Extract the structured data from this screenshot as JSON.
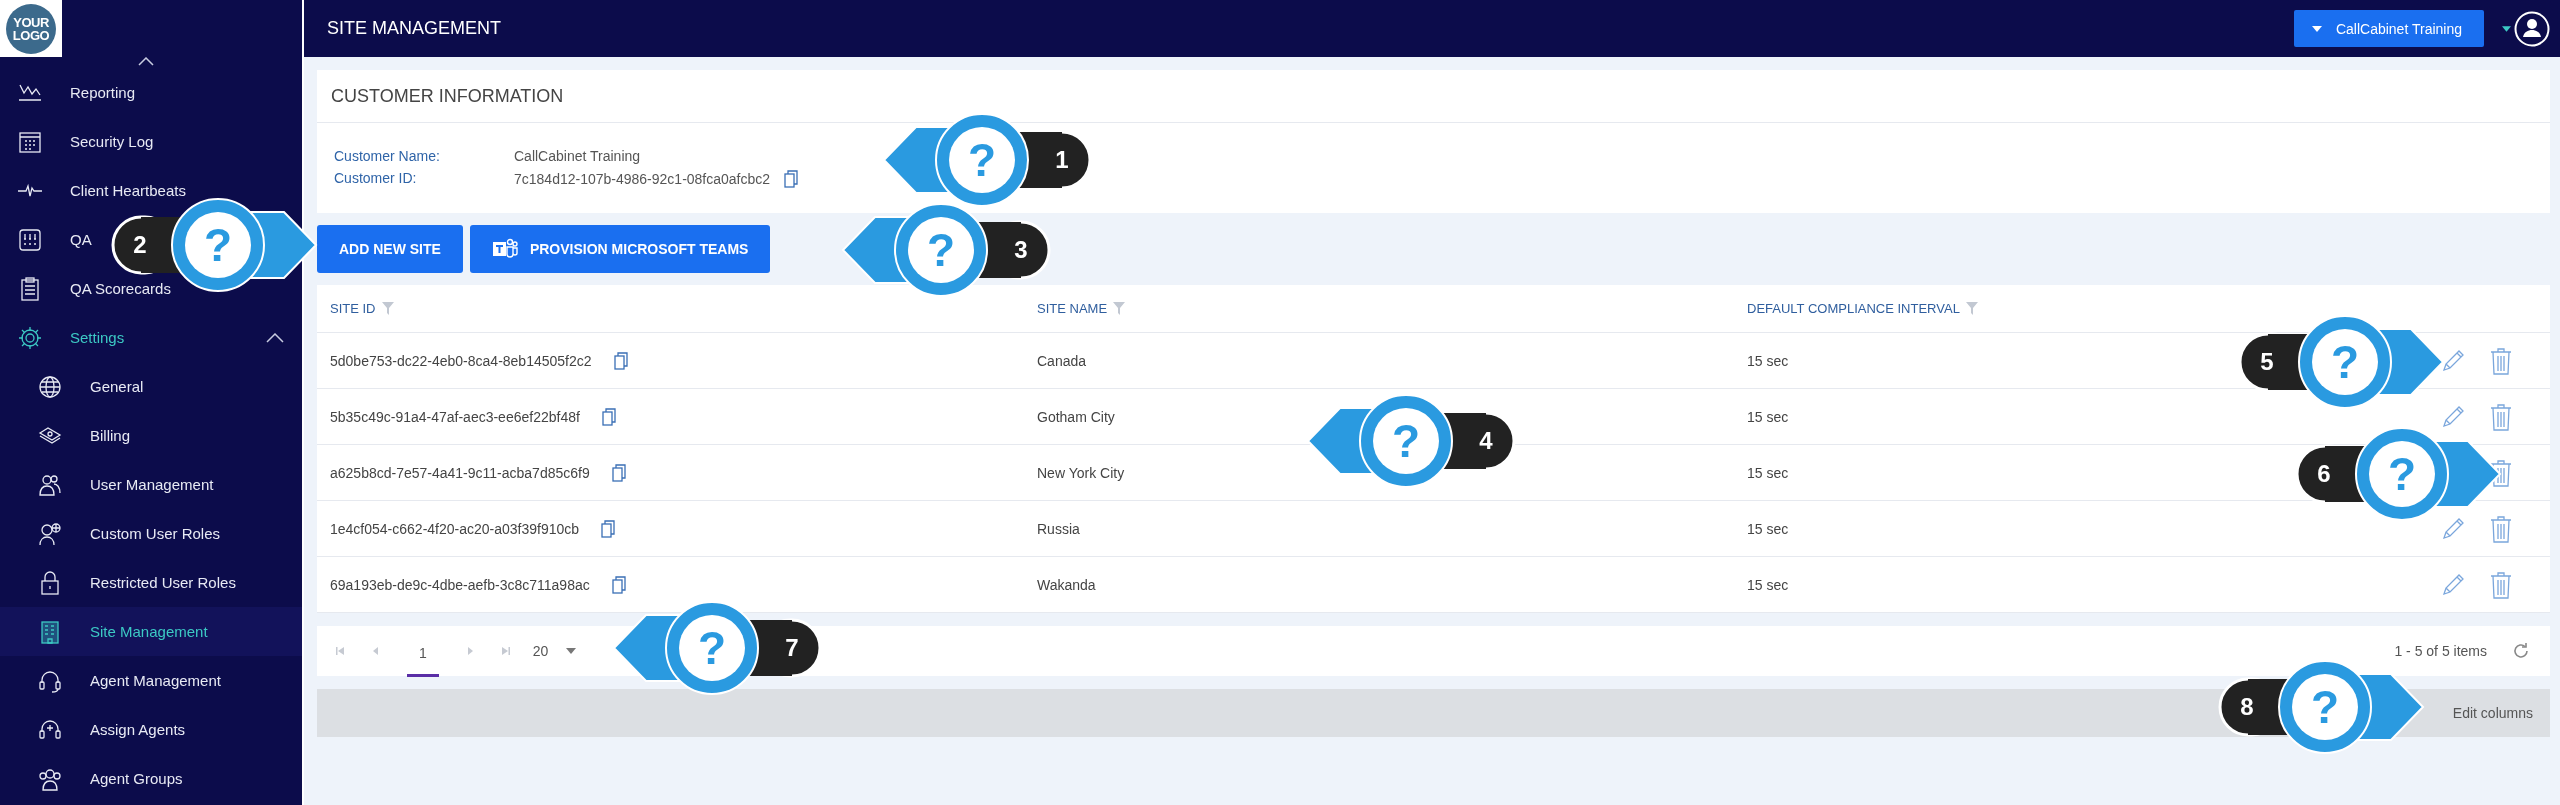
{
  "logo": {
    "line_1": "YOUR",
    "line_2": "LOGO"
  },
  "sidebar": {
    "items": [
      {
        "label": "Reporting",
        "selected": false
      },
      {
        "label": "Security Log",
        "selected": false
      },
      {
        "label": "Client Heartbeats",
        "selected": false
      },
      {
        "label": "QA",
        "selected": false
      },
      {
        "label": "QA Scorecards",
        "selected": false
      },
      {
        "label": "Settings",
        "selected": false,
        "expanded": true,
        "children": [
          {
            "label": "General",
            "selected": false
          },
          {
            "label": "Billing",
            "selected": false
          },
          {
            "label": "User Management",
            "selected": false
          },
          {
            "label": "Custom User Roles",
            "selected": false
          },
          {
            "label": "Restricted User Roles",
            "selected": false
          },
          {
            "label": "Site Management",
            "selected": true
          },
          {
            "label": "Agent Management",
            "selected": false
          },
          {
            "label": "Assign Agents",
            "selected": false
          },
          {
            "label": "Agent Groups",
            "selected": false
          }
        ]
      }
    ]
  },
  "header": {
    "title": "SITE MANAGEMENT",
    "account_button": "CallCabinet Training"
  },
  "customer_info": {
    "title": "CUSTOMER INFORMATION",
    "fields": [
      {
        "label": "Customer Name:",
        "value": "CallCabinet Training",
        "copyable": false
      },
      {
        "label": "Customer ID:",
        "value": "7c184d12-107b-4986-92c1-08fca0afcbc2",
        "copyable": true
      }
    ]
  },
  "buttons": [
    {
      "label": "ADD NEW SITE",
      "kind": "plain"
    },
    {
      "label": "PROVISION MICROSOFT TEAMS",
      "kind": "teams"
    }
  ],
  "table": {
    "columns": [
      {
        "label": "SITE ID"
      },
      {
        "label": "SITE NAME"
      },
      {
        "label": "DEFAULT COMPLIANCE INTERVAL"
      }
    ],
    "rows": [
      {
        "site_id": "5d0be753-dc22-4eb0-8ca4-8eb14505f2c2",
        "site_name": "Canada",
        "interval": "15 sec"
      },
      {
        "site_id": "5b35c49c-91a4-47af-aec3-ee6ef22bf48f",
        "site_name": "Gotham City",
        "interval": "15 sec"
      },
      {
        "site_id": "a625b8cd-7e57-4a41-9c11-acba7d85c6f9",
        "site_name": "New York City",
        "interval": "15 sec"
      },
      {
        "site_id": "1e4cf054-c662-4f20-ac20-a03f39f910cb",
        "site_name": "Russia",
        "interval": "15 sec"
      },
      {
        "site_id": "69a193eb-de9c-4dbe-aefb-3c8c711a98ac",
        "site_name": "Wakanda",
        "interval": "15 sec"
      }
    ]
  },
  "pager": {
    "pages": [
      {
        "label": "1",
        "selected": true
      }
    ],
    "page_size": "20",
    "summary": "1 - 5 of 5 items"
  },
  "footer": {
    "edit_columns": "Edit columns"
  },
  "callouts": [
    {
      "number": "1",
      "mark": "?",
      "kind": "leftward"
    },
    {
      "number": "2",
      "mark": "?",
      "kind": "rightward"
    },
    {
      "number": "3",
      "mark": "?",
      "kind": "leftward"
    },
    {
      "number": "4",
      "mark": "?",
      "kind": "leftward"
    },
    {
      "number": "5",
      "mark": "?",
      "kind": "rightward"
    },
    {
      "number": "6",
      "mark": "?",
      "kind": "rightward"
    },
    {
      "number": "7",
      "mark": "?",
      "kind": "leftward"
    },
    {
      "number": "8",
      "mark": "?",
      "kind": "rightward"
    }
  ]
}
